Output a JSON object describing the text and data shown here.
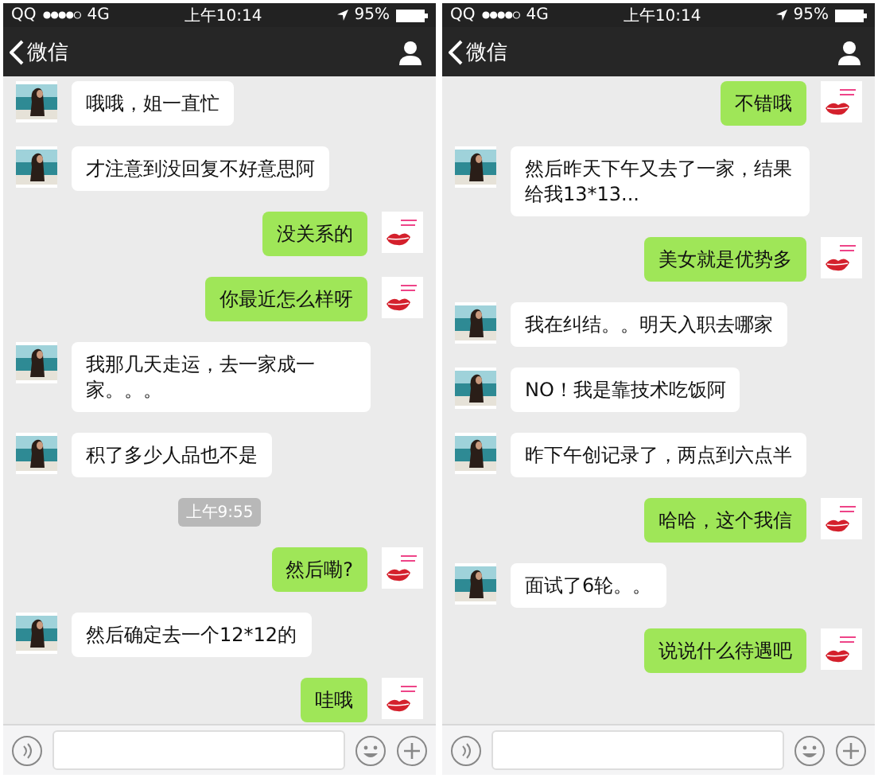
{
  "screens": [
    {
      "status_bar": {
        "carrier": "QQ",
        "network": "4G",
        "time": "上午10:14",
        "battery": "95%"
      },
      "nav_bar": {
        "back": "微信"
      },
      "messages": [
        {
          "kind": "received",
          "text": "哦哦，姐一直忙"
        },
        {
          "kind": "received",
          "text": "才注意到没回复不好意思阿"
        },
        {
          "kind": "sent",
          "text": "没关系的"
        },
        {
          "kind": "sent",
          "text": "你最近怎么样呀"
        },
        {
          "kind": "received",
          "text": "我那几天走运，去一家成一家。。。"
        },
        {
          "kind": "received",
          "text": "积了多少人品也不是"
        },
        {
          "kind": "time",
          "text": "上午9:55"
        },
        {
          "kind": "sent",
          "text": "然后嘞?"
        },
        {
          "kind": "received",
          "text": "然后确定去一个12*12的"
        },
        {
          "kind": "sent",
          "text": "哇哦"
        }
      ]
    },
    {
      "status_bar": {
        "carrier": "QQ",
        "network": "4G",
        "time": "上午10:14",
        "battery": "95%"
      },
      "nav_bar": {
        "back": "微信"
      },
      "messages": [
        {
          "kind": "sent",
          "text": "不错哦"
        },
        {
          "kind": "received",
          "text": "然后昨天下午又去了一家，结果给我13*13..."
        },
        {
          "kind": "sent",
          "text": "美女就是优势多"
        },
        {
          "kind": "received",
          "text": "我在纠结。。明天入职去哪家"
        },
        {
          "kind": "received",
          "text": "NO！我是靠技术吃饭阿"
        },
        {
          "kind": "received",
          "text": "昨下午创记录了，两点到六点半"
        },
        {
          "kind": "sent",
          "text": "哈哈，这个我信"
        },
        {
          "kind": "received",
          "text": "面试了6轮。。"
        },
        {
          "kind": "sent",
          "text": "说说什么待遇吧"
        }
      ]
    }
  ]
}
